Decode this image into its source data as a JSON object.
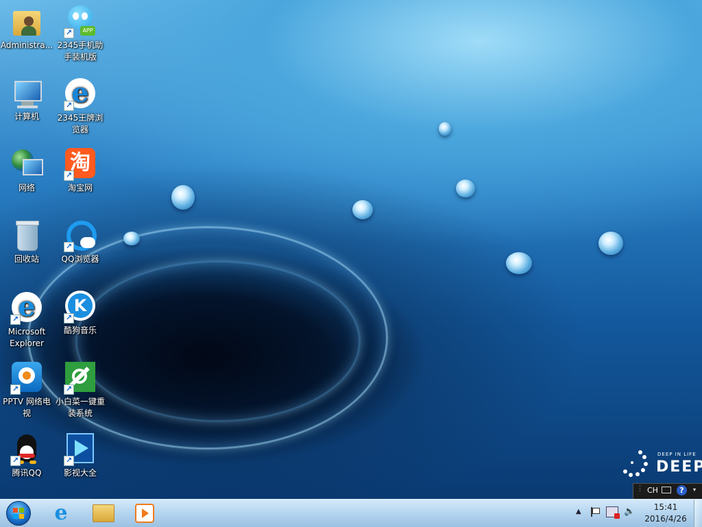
{
  "desktop_icons": [
    {
      "label": "Administra...",
      "icon": "user-folder-icon"
    },
    {
      "label": "2345手机助手装机版",
      "icon": "phone-assistant-icon"
    },
    {
      "label": "计算机",
      "icon": "computer-icon"
    },
    {
      "label": "2345王牌浏览器",
      "icon": "browser-2345-icon"
    },
    {
      "label": "网络",
      "icon": "network-icon"
    },
    {
      "label": "淘宝网",
      "icon": "taobao-icon"
    },
    {
      "label": "回收站",
      "icon": "recycle-bin-icon"
    },
    {
      "label": "QQ浏览器",
      "icon": "qq-browser-icon"
    },
    {
      "label": "Microsoft Explorer",
      "icon": "ie-icon"
    },
    {
      "label": "酷狗音乐",
      "icon": "kugou-icon"
    },
    {
      "label": "PPTV 网络电视",
      "icon": "pptv-icon"
    },
    {
      "label": "小白菜一键重装系统",
      "icon": "reinstall-icon"
    },
    {
      "label": "腾讯QQ",
      "icon": "qq-penguin-icon"
    },
    {
      "label": "影视大全",
      "icon": "video-player-icon"
    }
  ],
  "taobao_glyph": "淘",
  "kugou_glyph": "K",
  "app_badge": "APP",
  "deepin": {
    "tagline": "DEEP IN LIFE",
    "name": "DEEPI"
  },
  "langbar": {
    "lang": "CH",
    "help": "?"
  },
  "taskbar": {
    "pinned": [
      "start-orb-icon",
      "ie-icon",
      "explorer-icon",
      "media-player-icon"
    ],
    "tray_arrow": "▲",
    "time": "15:41",
    "date": "2016/4/26"
  },
  "colors": {
    "sky": "#4aa6dd",
    "deep": "#0a3a72",
    "taskbar": "#b0d2ee"
  }
}
